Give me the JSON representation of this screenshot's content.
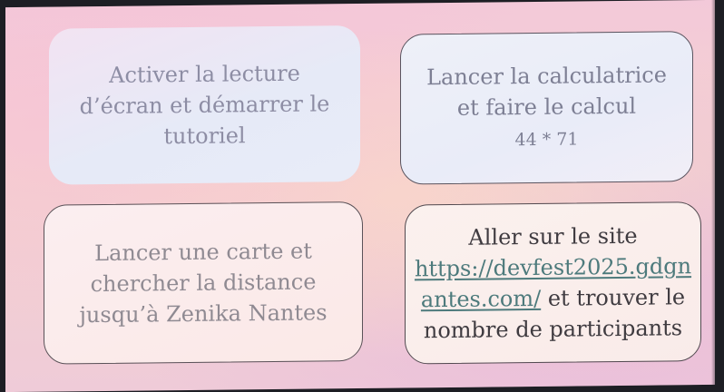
{
  "cards": {
    "top_left": {
      "lines": [
        "Activer la lecture",
        "d’écran et démarrer le",
        "tutoriel"
      ]
    },
    "top_right": {
      "lines": [
        "Lancer la calculatrice",
        "et faire le calcul"
      ],
      "formula": "44 * 71"
    },
    "bottom_left": {
      "lines": [
        "Lancer une carte et",
        "chercher la distance",
        "jusqu’à Zenika Nantes"
      ]
    },
    "bottom_right": {
      "line1": "Aller sur le site",
      "url_part1": "https://devfest2025.gdgn",
      "url_part2": "antes.com/",
      "line3_rest": " et trouver le",
      "line4": "nombre de participants"
    }
  }
}
